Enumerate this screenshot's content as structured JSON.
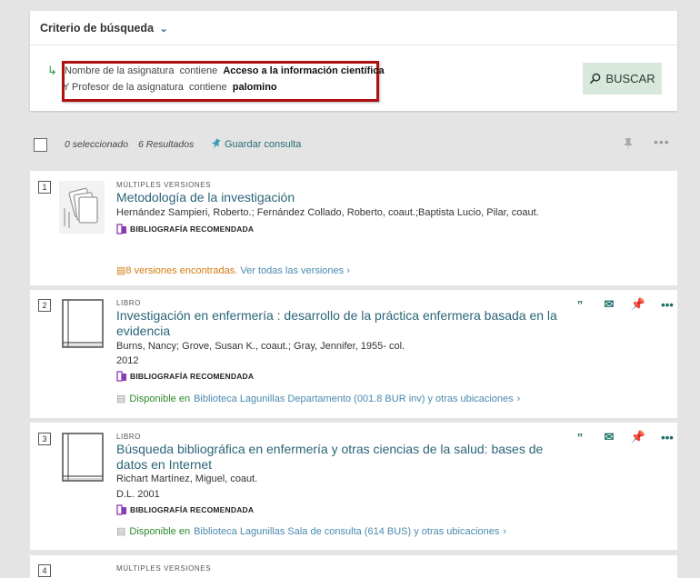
{
  "search": {
    "header": "Criterio de búsqueda",
    "line1": {
      "field": "Nombre de la asignatura",
      "op": "contiene",
      "value": "Acceso a la información científica"
    },
    "joiner": "Y",
    "line2": {
      "field": "Profesor de la asignatura",
      "op": "contiene",
      "value": "palomino"
    },
    "button": "BUSCAR"
  },
  "toolbar": {
    "selected": "0 seleccionado",
    "results": "6 Resultados",
    "save_query": "Guardar consulta"
  },
  "results": [
    {
      "num": "1",
      "type": "MÚLTIPLES VERSIONES",
      "title": "Metodología de la investigación",
      "authors": "Hernández Sampieri, Roberto.; Fernández Collado, Roberto, coaut.;Baptista Lucio, Pilar, coaut.",
      "biblio": "BIBLIOGRAFÍA RECOMENDADA",
      "versions_found": "8 versiones encontradas.",
      "versions_link": "Ver todas las versiones"
    },
    {
      "num": "2",
      "type": "LIBRO",
      "title": "Investigación en enfermería : desarrollo de la práctica enfermera basada en la evidencia",
      "authors": "Burns, Nancy; Grove, Susan K., coaut.; Gray, Jennifer, 1955- col.",
      "year": "2012",
      "biblio": "BIBLIOGRAFÍA RECOMENDADA",
      "avail_status": "Disponible en",
      "avail_location": "Biblioteca Lagunillas  Departamento (001.8 BUR inv) y otras ubicaciones"
    },
    {
      "num": "3",
      "type": "LIBRO",
      "title": "Búsqueda bibliográfica en enfermería y otras ciencias de la salud: bases de datos en Internet",
      "authors": "Richart Martínez, Miguel, coaut.",
      "year": "D.L. 2001",
      "biblio": "BIBLIOGRAFÍA RECOMENDADA",
      "avail_status": "Disponible en",
      "avail_location": "Biblioteca Lagunillas  Sala de consulta (614 BUS) y otras ubicaciones"
    },
    {
      "num": "4",
      "type": "MÚLTIPLES VERSIONES"
    }
  ],
  "icons": [
    "chevron-down-icon",
    "arrow-icon",
    "search-icon",
    "pin-icon",
    "more-icon",
    "quote-icon",
    "email-icon",
    "book-icon",
    "versions-icon"
  ]
}
